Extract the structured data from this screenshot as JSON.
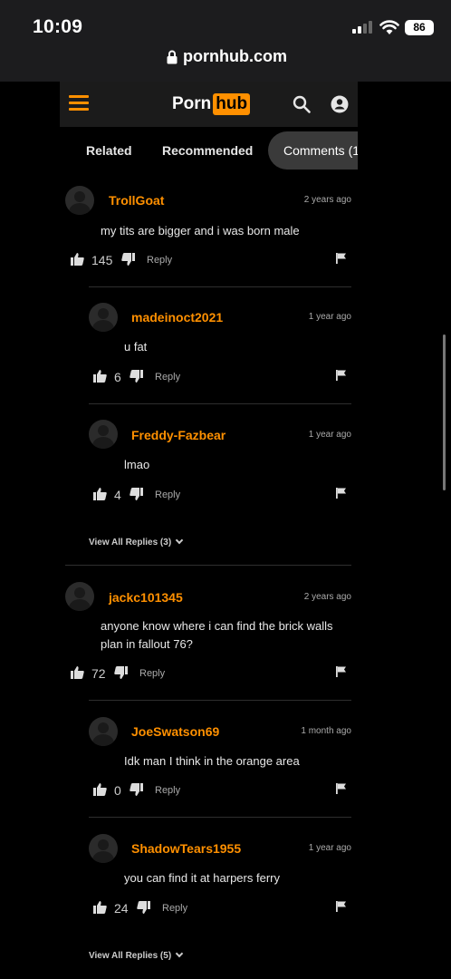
{
  "status_bar": {
    "time": "10:09",
    "battery": "86"
  },
  "browser": {
    "url": "pornhub.com"
  },
  "site": {
    "logo_left": "Porn",
    "logo_right": "hub"
  },
  "tabs": {
    "related": "Related",
    "recommended": "Recommended",
    "comments": "Comments (1"
  },
  "comments": [
    {
      "user": "TrollGoat",
      "time": "2 years ago",
      "text": "my tits are bigger and i was born male",
      "likes": "145",
      "reply": "Reply"
    },
    {
      "user": "madeinoct2021",
      "time": "1 year ago",
      "text": "u fat",
      "likes": "6",
      "reply": "Reply"
    },
    {
      "user": "Freddy-Fazbear",
      "time": "1 year ago",
      "text": "lmao",
      "likes": "4",
      "reply": "Reply"
    },
    {
      "user": "jackc101345",
      "time": "2 years ago",
      "text": "anyone know where i can find the brick walls plan in fallout 76?",
      "likes": "72",
      "reply": "Reply"
    },
    {
      "user": "JoeSwatson69",
      "time": "1 month ago",
      "text": "Idk man I think in the orange area",
      "likes": "0",
      "reply": "Reply"
    },
    {
      "user": "ShadowTears1955",
      "time": "1 year ago",
      "text": "you can find it at harpers ferry",
      "likes": "24",
      "reply": "Reply"
    }
  ],
  "view_all": [
    "View All Replies (3)",
    "View All Replies (5)"
  ],
  "colors": {
    "accent": "#ff9000",
    "background": "#000000",
    "header": "#1b1b1b"
  }
}
